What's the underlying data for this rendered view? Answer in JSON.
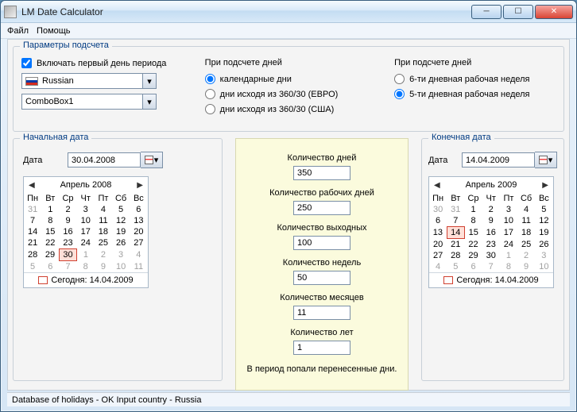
{
  "window": {
    "title": "LM Date Calculator"
  },
  "menu": {
    "file": "Файл",
    "help": "Помощь"
  },
  "params": {
    "legend": "Параметры подсчета",
    "include_first_day": "Включать первый день периода",
    "language_display": "Russian",
    "combobox1": "ComboBox1",
    "days_mode_label": "При подсчете дней",
    "opt_calendar": "календарные дни",
    "opt_360_euro": "дни исходя из 360/30 (ЕВРО)",
    "opt_360_usa": "дни исходя из 360/30 (США)",
    "week_mode_label": "При подсчете дней",
    "opt_6day": "6-ти дневная рабочая неделя",
    "opt_5day": "5-ти дневная рабочая неделя"
  },
  "start": {
    "legend": "Начальная дата",
    "date_label": "Дата",
    "date_value": "30.04.2008",
    "month_title": "Апрель 2008",
    "weekdays": [
      "Пн",
      "Вт",
      "Ср",
      "Чт",
      "Пт",
      "Сб",
      "Вс"
    ],
    "today_label": "Сегодня: 14.04.2009"
  },
  "end": {
    "legend": "Конечная дата",
    "date_label": "Дата",
    "date_value": "14.04.2009",
    "month_title": "Апрель 2009",
    "weekdays": [
      "Пн",
      "Вт",
      "Ср",
      "Чт",
      "Пт",
      "Сб",
      "Вс"
    ],
    "today_label": "Сегодня: 14.04.2009"
  },
  "results": {
    "days_label": "Количество дней",
    "days": "350",
    "workdays_label": "Количество рабочих дней",
    "workdays": "250",
    "dayoffs_label": "Количество выходных",
    "dayoffs": "100",
    "weeks_label": "Количество недель",
    "weeks": "50",
    "months_label": "Количество месяцев",
    "months": "11",
    "years_label": "Количество лет",
    "years": "1",
    "note": "В период попали перенесенные дни."
  },
  "status": "Database of holidays - OK  Input country - Russia",
  "chart_data": {
    "type": "table",
    "title": "Date interval results",
    "rows": [
      {
        "metric": "Количество дней",
        "value": 350
      },
      {
        "metric": "Количество рабочих дней",
        "value": 250
      },
      {
        "metric": "Количество выходных",
        "value": 100
      },
      {
        "metric": "Количество недель",
        "value": 50
      },
      {
        "metric": "Количество месяцев",
        "value": 11
      },
      {
        "metric": "Количество лет",
        "value": 1
      }
    ],
    "start_date": "30.04.2008",
    "end_date": "14.04.2009"
  }
}
